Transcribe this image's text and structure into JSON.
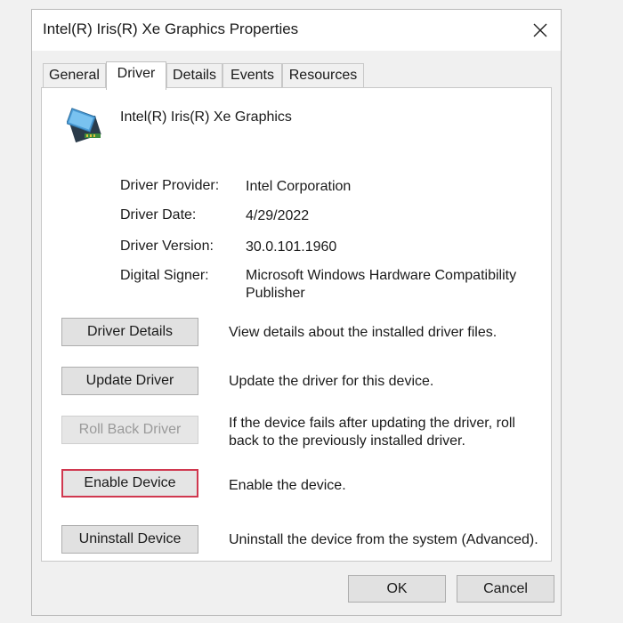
{
  "window": {
    "title": "Intel(R) Iris(R) Xe Graphics Properties",
    "close_icon": "close-icon"
  },
  "tabs": [
    {
      "label": "General",
      "active": false
    },
    {
      "label": "Driver",
      "active": true
    },
    {
      "label": "Details",
      "active": false
    },
    {
      "label": "Events",
      "active": false
    },
    {
      "label": "Resources",
      "active": false
    }
  ],
  "device": {
    "icon": "display-adapter-icon",
    "name": "Intel(R) Iris(R) Xe Graphics"
  },
  "properties": [
    {
      "label": "Driver Provider:",
      "value": "Intel Corporation"
    },
    {
      "label": "Driver Date:",
      "value": "4/29/2022"
    },
    {
      "label": "Driver Version:",
      "value": "30.0.101.1960"
    },
    {
      "label": "Digital Signer:",
      "value": "Microsoft Windows Hardware Compatibility Publisher"
    }
  ],
  "actions": [
    {
      "button": "Driver Details",
      "description": "View details about the installed driver files.",
      "enabled": true
    },
    {
      "button": "Update Driver",
      "description": "Update the driver for this device.",
      "enabled": true
    },
    {
      "button": "Roll Back Driver",
      "description": "If the device fails after updating the driver, roll back to the previously installed driver.",
      "enabled": false
    },
    {
      "button": "Enable Device",
      "description": "Enable the device.",
      "enabled": true,
      "highlighted": true
    },
    {
      "button": "Uninstall Device",
      "description": "Uninstall the device from the system (Advanced).",
      "enabled": true
    }
  ],
  "footer": {
    "ok_label": "OK",
    "cancel_label": "Cancel"
  },
  "colors": {
    "highlight_border": "#d0384f",
    "dialog_bg": "#f0f0f0",
    "panel_bg": "#ffffff"
  }
}
